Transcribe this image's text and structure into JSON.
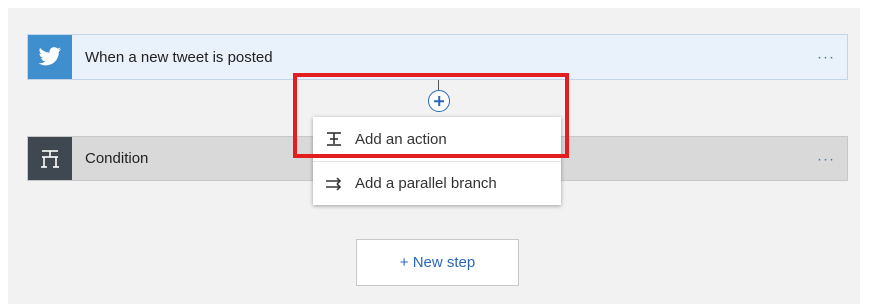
{
  "trigger": {
    "title": "When a new tweet is posted",
    "more": "···",
    "icon": "twitter-bird-icon",
    "color": "#3f8fcf"
  },
  "condition": {
    "title": "Condition",
    "more": "···",
    "icon": "condition-icon",
    "color": "#3f4750"
  },
  "insert": {
    "icon": "plus-circle-icon",
    "color": "#2b67b7"
  },
  "menu": {
    "items": [
      {
        "label": "Add an action",
        "icon": "add-action-icon"
      },
      {
        "label": "Add a parallel branch",
        "icon": "parallel-branch-icon"
      }
    ]
  },
  "highlight": {
    "color": "#e41e1e"
  },
  "new_step": {
    "label": "+ New step",
    "color": "#2b67b7"
  }
}
